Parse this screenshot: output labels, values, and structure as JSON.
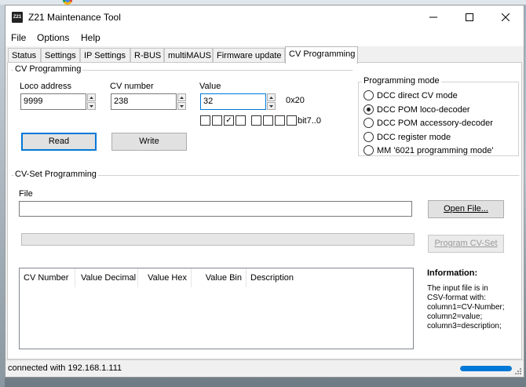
{
  "window": {
    "title": "Z21 Maintenance Tool",
    "app_icon_text": "Z21"
  },
  "menu": [
    "File",
    "Options",
    "Help"
  ],
  "tabs": [
    "Status",
    "Settings",
    "IP Settings",
    "R-BUS",
    "multiMAUS",
    "Firmware update",
    "CV Programming"
  ],
  "active_tab": "CV Programming",
  "cv_programming": {
    "legend": "CV Programming",
    "loco_label": "Loco address",
    "loco_value": "9999",
    "cv_label": "CV number",
    "cv_value": "238",
    "value_label": "Value",
    "value_value": "32",
    "hex_value": "0x20",
    "bits_label": "bit7..0",
    "bits": [
      0,
      0,
      1,
      0,
      0,
      0,
      0,
      0
    ],
    "read_label": "Read",
    "write_label": "Write"
  },
  "programming_mode": {
    "legend": "Programming mode",
    "options": [
      "DCC direct CV mode",
      "DCC POM loco-decoder",
      "DCC POM accessory-decoder",
      "DCC register mode",
      "MM '6021 programming mode'"
    ],
    "selected": "DCC POM loco-decoder"
  },
  "cv_set": {
    "legend": "CV-Set Programming",
    "file_label": "File",
    "file_value": "",
    "open_label": "Open File...",
    "program_label": "Program CV-Set",
    "progress": 0,
    "columns": [
      "CV Number",
      "Value Decimal",
      "Value Hex",
      "Value Bin",
      "Description"
    ],
    "rows": [],
    "info_title": "Information:",
    "info_lines": [
      "The input file is in",
      "CSV-format with:",
      "column1=CV-Number;",
      "column2=value;",
      "column3=description;"
    ]
  },
  "status": {
    "text": "connected with 192.168.1.111",
    "progress": 1.0
  }
}
